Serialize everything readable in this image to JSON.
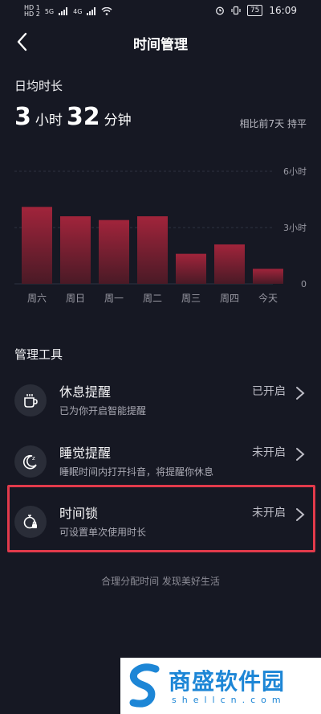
{
  "status_bar": {
    "left_tags": [
      "HD 1",
      "HD 2"
    ],
    "signal_labels": [
      "5G",
      "4G"
    ],
    "battery": "75",
    "time": "16:09"
  },
  "header": {
    "title": "时间管理"
  },
  "summary": {
    "label": "日均时长",
    "hours": "3",
    "hours_unit": "小时",
    "minutes": "32",
    "minutes_unit": "分钟",
    "compare": "相比前7天 持平"
  },
  "chart_data": {
    "type": "bar",
    "categories": [
      "周六",
      "周日",
      "周一",
      "周二",
      "周三",
      "周四",
      "今天"
    ],
    "values": [
      4.1,
      3.6,
      3.4,
      3.6,
      1.6,
      2.1,
      0.8
    ],
    "y_tick_labels": [
      "6小时",
      "3小时",
      "0"
    ],
    "ylim": [
      0,
      6
    ],
    "color_top": "#a1243b",
    "color_bottom": "#4a1a26",
    "grid": true
  },
  "tools": {
    "section_title": "管理工具",
    "items": [
      {
        "title": "休息提醒",
        "subtitle": "已为你开启智能提醒",
        "status": "已开启",
        "icon": "coffee-cup-icon"
      },
      {
        "title": "睡觉提醒",
        "subtitle": "睡眠时间内打开抖音，将提醒你休息",
        "status": "未开启",
        "icon": "moon-icon"
      },
      {
        "title": "时间锁",
        "subtitle": "可设置单次使用时长",
        "status": "未开启",
        "icon": "timer-lock-icon"
      }
    ]
  },
  "footer": {
    "text": "合理分配时间 发现美好生活"
  },
  "watermark": {
    "title": "商盛软件园",
    "subtitle": "shellcn.com"
  },
  "colors": {
    "background": "#161823",
    "highlight": "#e23a4b",
    "watermark": "#1d86d6"
  }
}
